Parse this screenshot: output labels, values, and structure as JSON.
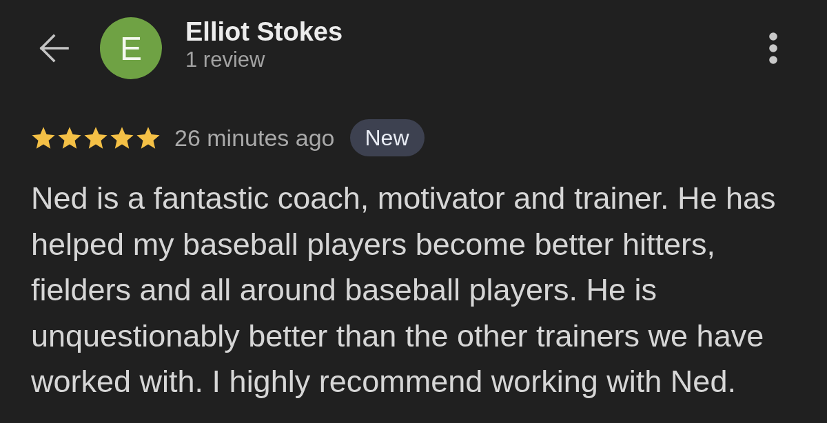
{
  "header": {
    "avatar_letter": "E",
    "name": "Elliot Stokes",
    "review_count": "1 review"
  },
  "review": {
    "stars": 5,
    "time": "26 minutes ago",
    "badge": "New",
    "text": "Ned is a fantastic coach, motivator and trainer. He has helped my baseball players become better hitters, fielders and all around baseball players. He is unquestionably better than the other trainers we have worked with. I highly recommend working with Ned."
  }
}
